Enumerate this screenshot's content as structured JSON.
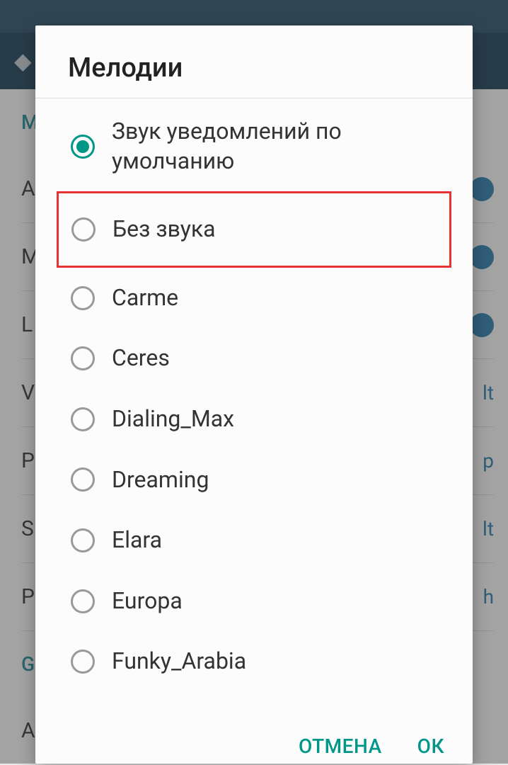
{
  "dialog": {
    "title": "Мелодии",
    "items": [
      {
        "label": "Звук уведомлений по умолчанию",
        "selected": true,
        "highlighted": false
      },
      {
        "label": "Без звука",
        "selected": false,
        "highlighted": true
      },
      {
        "label": "Carme",
        "selected": false,
        "highlighted": false
      },
      {
        "label": "Ceres",
        "selected": false,
        "highlighted": false
      },
      {
        "label": "Dialing_Max",
        "selected": false,
        "highlighted": false
      },
      {
        "label": "Dreaming",
        "selected": false,
        "highlighted": false
      },
      {
        "label": "Elara",
        "selected": false,
        "highlighted": false
      },
      {
        "label": "Europa",
        "selected": false,
        "highlighted": false
      },
      {
        "label": "Funky_Arabia",
        "selected": false,
        "highlighted": false
      }
    ],
    "cancel_label": "ОТМЕНА",
    "ok_label": "ОК"
  },
  "background": {
    "section_label": "M",
    "items": [
      {
        "left": "A",
        "right": ""
      },
      {
        "left": "M",
        "right": ""
      },
      {
        "left": "L",
        "right": ""
      },
      {
        "left": "V",
        "right": "lt"
      },
      {
        "left": "P",
        "right": "p"
      },
      {
        "left": "S",
        "right": "lt"
      },
      {
        "left": "P",
        "right": "h"
      }
    ],
    "section2_label": "G",
    "items2": [
      {
        "left": "A",
        "right": ""
      }
    ]
  }
}
